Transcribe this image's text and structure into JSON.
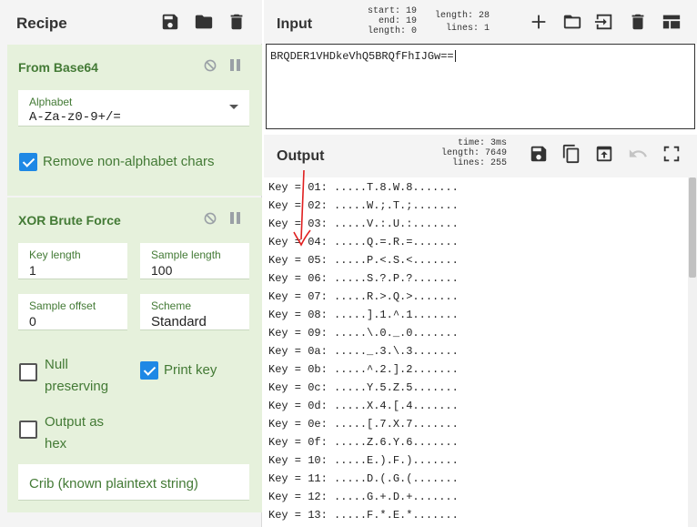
{
  "recipe": {
    "title": "Recipe",
    "operations": [
      {
        "title": "From Base64",
        "alphabet": {
          "label": "Alphabet",
          "value": "A-Za-z0-9+/="
        },
        "remove_non_alphabet": {
          "label": "Remove non-alphabet chars",
          "checked": true
        }
      },
      {
        "title": "XOR Brute Force",
        "key_length": {
          "label": "Key length",
          "value": "1"
        },
        "sample_length": {
          "label": "Sample length",
          "value": "100"
        },
        "sample_offset": {
          "label": "Sample offset",
          "value": "0"
        },
        "scheme": {
          "label": "Scheme",
          "value": "Standard"
        },
        "null_preserving": {
          "label1": "Null",
          "label2": "preserving",
          "checked": false
        },
        "print_key": {
          "label": "Print key",
          "checked": true
        },
        "output_hex": {
          "label1": "Output as",
          "label2": "hex",
          "checked": false
        },
        "crib": {
          "placeholder": "Crib (known plaintext string)"
        }
      }
    ]
  },
  "input": {
    "title": "Input",
    "stats": {
      "start": "start: 19",
      "end": "end: 19",
      "length": "length: 0",
      "total_length": "length: 28",
      "lines": "lines: 1"
    },
    "text": "BRQDER1VHDkeVhQ5BRQfFhIJGw=="
  },
  "output": {
    "title": "Output",
    "stats": {
      "time": "time: 3ms",
      "length": "length: 7649",
      "lines": "lines: 255"
    },
    "rows": [
      "Key = 01: .....T.8.W.8.......",
      "Key = 02: .....W.;.T.;.......",
      "Key = 03: .....V.:.U.:.......",
      "Key = 04: .....Q.=.R.=.......",
      "Key = 05: .....P.<.S.<.......",
      "Key = 06: .....S.?.P.?.......",
      "Key = 07: .....R.>.Q.>.......",
      "Key = 08: .....].1.^.1.......",
      "Key = 09: .....\\.0._.0.......",
      "Key = 0a: ....._.3.\\.3.......",
      "Key = 0b: .....^.2.].2.......",
      "Key = 0c: .....Y.5.Z.5.......",
      "Key = 0d: .....X.4.[.4.......",
      "Key = 0e: .....[.7.X.7.......",
      "Key = 0f: .....Z.6.Y.6.......",
      "Key = 10: .....E.).F.).......",
      "Key = 11: .....D.(.G.(.......",
      "Key = 12: .....G.+.D.+.......",
      "Key = 13: .....F.*.E.*......."
    ]
  },
  "colors": {
    "op_bg": "#e6f1dc",
    "op_title": "#437a35",
    "check_on": "#1e88e5",
    "annotation": "#e02020"
  }
}
